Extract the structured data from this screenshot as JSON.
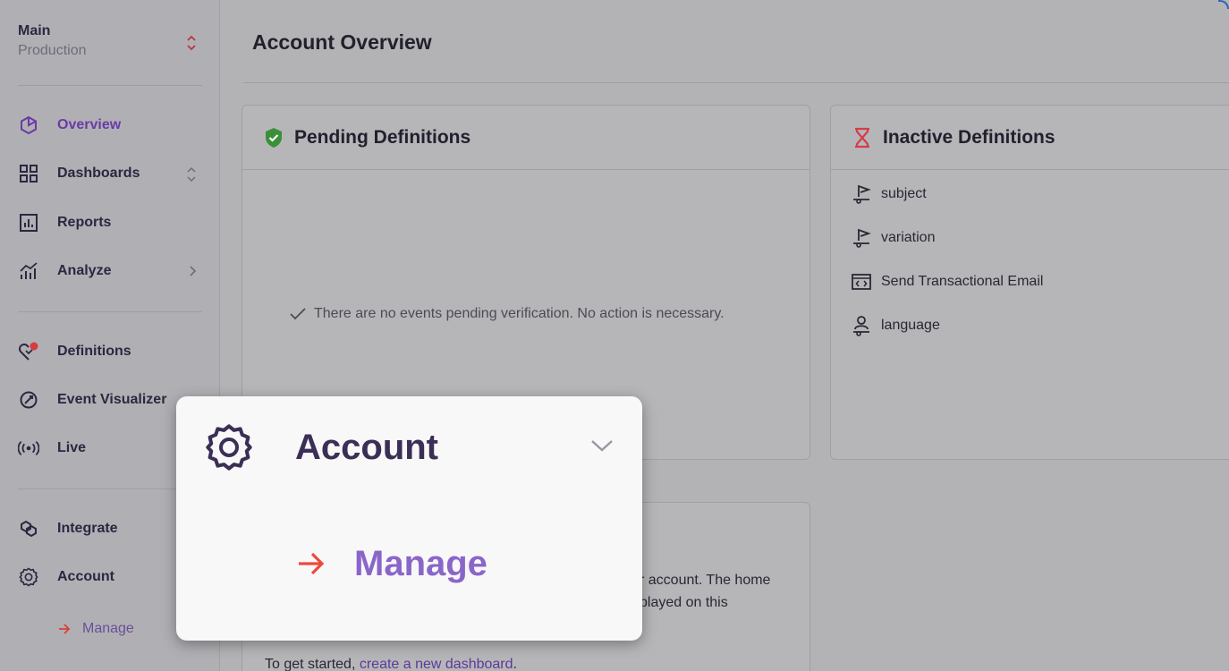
{
  "sidebar": {
    "project_name": "Main",
    "project_env": "Production",
    "items": [
      {
        "label": "Overview",
        "icon": "overview-hexagon-icon",
        "active": true
      },
      {
        "label": "Dashboards",
        "icon": "dashboard-grid-icon"
      },
      {
        "label": "Reports",
        "icon": "report-chart-icon"
      },
      {
        "label": "Analyze",
        "icon": "analyze-bars-icon"
      },
      {
        "label": "Definitions",
        "icon": "definitions-heart-icon"
      },
      {
        "label": "Event Visualizer",
        "icon": "event-visualizer-icon"
      },
      {
        "label": "Live",
        "icon": "live-broadcast-icon"
      },
      {
        "label": "Integrate",
        "icon": "integrate-link-icon"
      },
      {
        "label": "Account",
        "icon": "gear-icon"
      }
    ],
    "sub_item": {
      "label": "Manage"
    }
  },
  "main": {
    "title": "Account Overview",
    "pending": {
      "title": "Pending Definitions",
      "empty_message": "There are no events pending verification. No action is necessary."
    },
    "inactive": {
      "title": "Inactive Definitions",
      "items": [
        {
          "label": "subject",
          "icon": "property-flag-icon"
        },
        {
          "label": "variation",
          "icon": "property-flag-icon"
        },
        {
          "label": "Send Transactional Email",
          "icon": "code-window-icon"
        },
        {
          "label": "language",
          "icon": "user-property-icon"
        }
      ]
    },
    "bottom_card": {
      "line1": "r account. The home",
      "line2": "played on this",
      "line3_prefix": "To get started,",
      "line3_link": "create a new dashboard",
      "line3_suffix": "."
    }
  },
  "popup": {
    "title": "Account",
    "sub_label": "Manage"
  },
  "colors": {
    "accent_purple": "#6b3aa7",
    "arrow_red": "#e04a3f",
    "pending_green": "#3b8f3a"
  }
}
